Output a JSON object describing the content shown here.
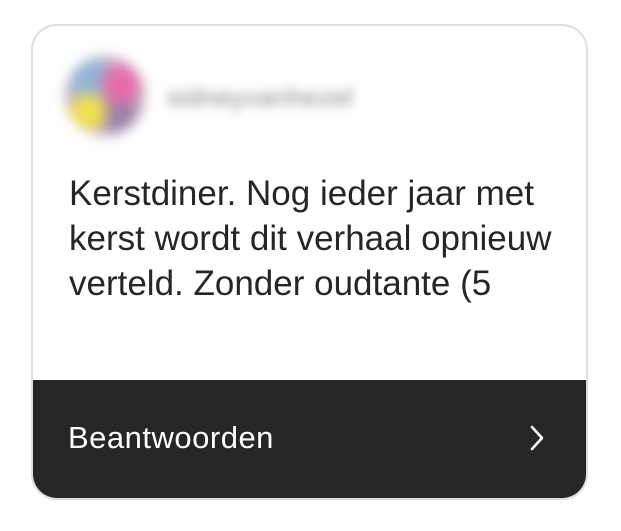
{
  "post": {
    "username": "sidneyvanhezel",
    "message": "Kerstdiner. Nog ieder jaar met kerst wordt dit verhaal opnieuw verteld. Zonder oudtante (5"
  },
  "reply": {
    "label": "Beantwoorden"
  },
  "icons": {
    "avatar": "avatar",
    "reply_chevron": "chevron-right-icon"
  },
  "colors": {
    "reply_bar_background": "#262626",
    "text_primary": "#262626",
    "reply_text": "#ffffff",
    "card_border": "#dedede"
  }
}
